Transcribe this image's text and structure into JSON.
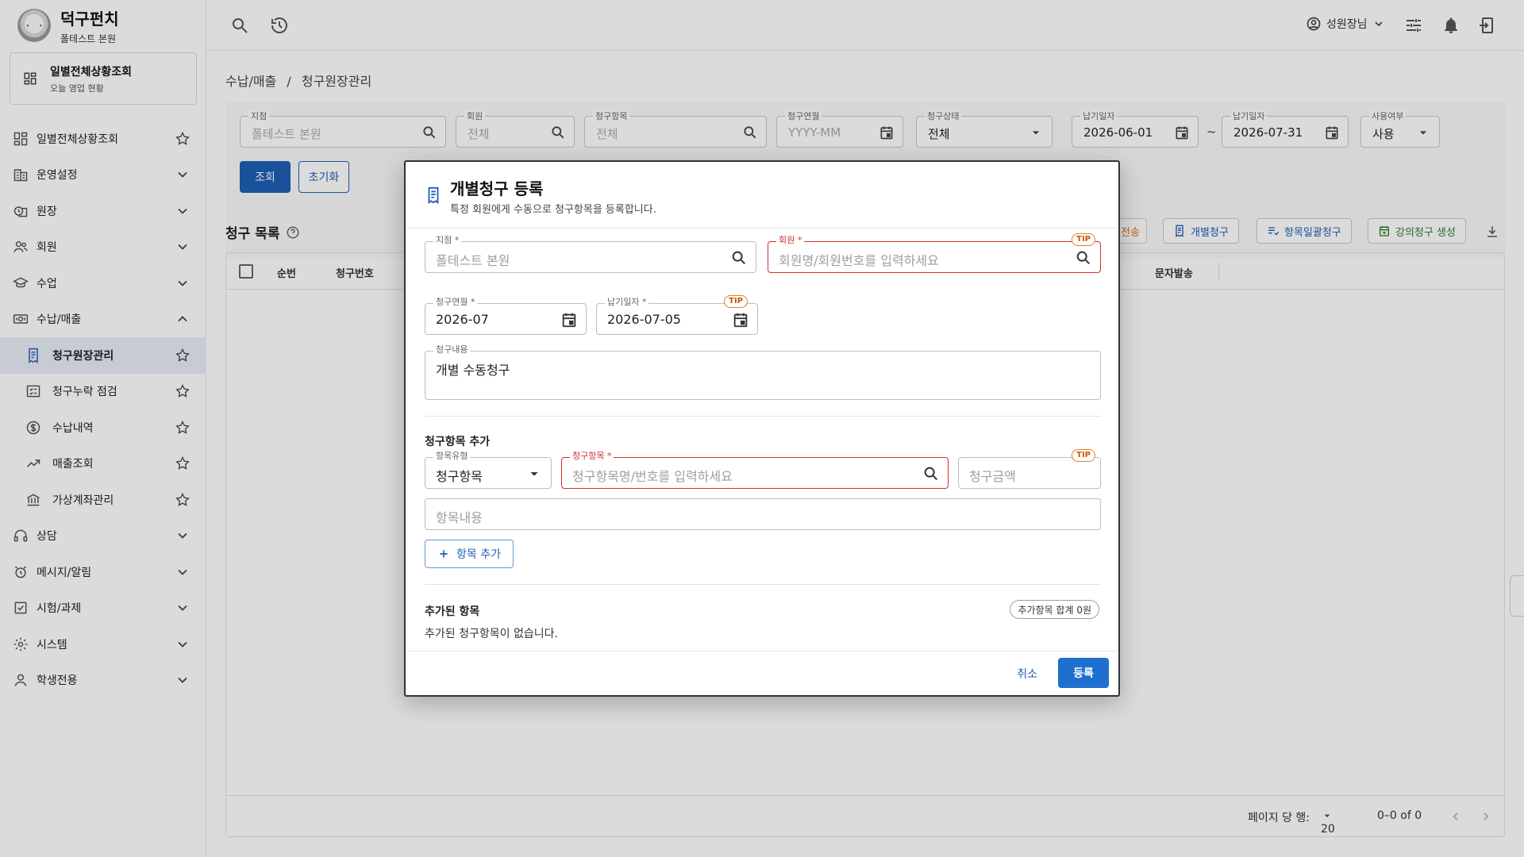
{
  "brand": {
    "title": "덕구펀치",
    "subtitle": "폴테스트 본원"
  },
  "quick_card": {
    "title": "일별전체상황조회",
    "subtitle": "오늘 영업 현황"
  },
  "sidebar": {
    "items": [
      {
        "label": "일별전체상황조회",
        "icon": "dashboard-icon",
        "tail": "star"
      },
      {
        "label": "운영설정",
        "icon": "building-icon",
        "tail": "chevron-down"
      },
      {
        "label": "원장",
        "icon": "ledger-icon",
        "tail": "chevron-down"
      },
      {
        "label": "회원",
        "icon": "people-icon",
        "tail": "chevron-down"
      },
      {
        "label": "수업",
        "icon": "school-icon",
        "tail": "chevron-down"
      },
      {
        "label": "수납/매출",
        "icon": "cash-icon",
        "tail": "chevron-up"
      },
      {
        "label": "청구원장관리",
        "icon": "receipt-icon",
        "tail": "star",
        "sub": true,
        "active": true
      },
      {
        "label": "청구누락 점검",
        "icon": "checklist-icon",
        "tail": "star",
        "sub": true
      },
      {
        "label": "수납내역",
        "icon": "dollar-icon",
        "tail": "star",
        "sub": true
      },
      {
        "label": "매출조회",
        "icon": "trend-icon",
        "tail": "star",
        "sub": true
      },
      {
        "label": "가상계좌관리",
        "icon": "bank-icon",
        "tail": "star",
        "sub": true
      },
      {
        "label": "상담",
        "icon": "headset-icon",
        "tail": "chevron-down"
      },
      {
        "label": "메시지/알림",
        "icon": "alarm-icon",
        "tail": "chevron-down"
      },
      {
        "label": "시험/과제",
        "icon": "task-icon",
        "tail": "chevron-down"
      },
      {
        "label": "시스템",
        "icon": "gear-icon",
        "tail": "chevron-down"
      },
      {
        "label": "학생전용",
        "icon": "person-icon",
        "tail": "chevron-down"
      }
    ]
  },
  "topbar": {
    "user_label": "성원장님"
  },
  "breadcrumb": {
    "parent": "수납/매출",
    "separator": "/",
    "current": "청구원장관리"
  },
  "filters": {
    "branch": {
      "label": "지점",
      "value": "폴테스트 본원"
    },
    "member": {
      "label": "회원",
      "value": "전체"
    },
    "item": {
      "label": "청구항목",
      "value": "전체"
    },
    "bill_month": {
      "label": "청구연월",
      "placeholder": "YYYY-MM"
    },
    "status": {
      "label": "청구상태",
      "value": "전체"
    },
    "due_from": {
      "label": "납기일자",
      "value": "2026-06-01"
    },
    "range_sep": "~",
    "due_to": {
      "label": "납기일자",
      "value": "2026-07-31"
    },
    "use": {
      "label": "사용여부",
      "value": "사용"
    },
    "search_button": "조회",
    "reset_button": "초기화"
  },
  "list": {
    "title": "청구 목록",
    "actions": {
      "send": "전송",
      "individual": "개별청구",
      "bulk": "항목일괄청구",
      "lecture": "강의청구 생성"
    },
    "columns": {
      "no": "순번",
      "bill_no": "청구번호",
      "sms": "문자발송"
    },
    "footer": {
      "rows_label": "페이지 당 행:",
      "rows_value": "20",
      "range": "0–0 of 0"
    }
  },
  "modal": {
    "title": "개별청구 등록",
    "subtitle": "특정 회원에게 수동으로 청구항목을 등록합니다.",
    "branch": {
      "label": "지점 *",
      "value": "폴테스트 본원"
    },
    "member": {
      "label": "회원 *",
      "placeholder": "회원명/회원번호를 입력하세요"
    },
    "bill_month": {
      "label": "청구연월 *",
      "value": "2026-07"
    },
    "due_date": {
      "label": "납기일자 *",
      "value": "2026-07-05"
    },
    "content": {
      "label": "청구내용",
      "value": "개별 수동청구"
    },
    "tip": "TIP",
    "add_section": {
      "title": "청구항목 추가",
      "type": {
        "label": "항목유형",
        "value": "청구항목"
      },
      "item": {
        "label": "청구항목 *",
        "placeholder": "청구항목명/번호를 입력하세요"
      },
      "amount": {
        "placeholder": "청구금액"
      },
      "desc": {
        "placeholder": "항목내용"
      },
      "add_button": "항목 추가"
    },
    "added": {
      "title": "추가된 항목",
      "total_chip": "추가항목 합계 0원",
      "empty": "추가된 청구항목이 없습니다."
    },
    "cancel": "취소",
    "submit": "등록"
  },
  "colors": {
    "primary": "#1e5fb4",
    "error": "#d32f2f",
    "tip": "#e67e22"
  }
}
